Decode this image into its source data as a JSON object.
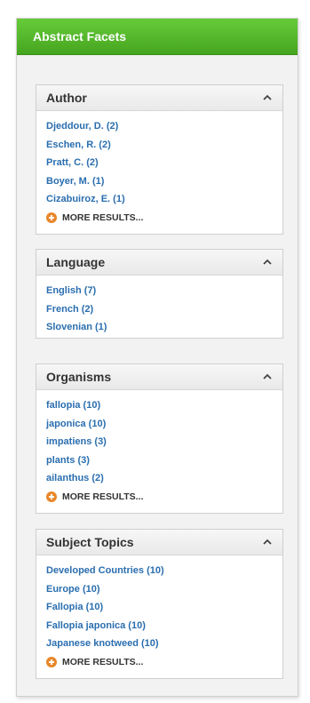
{
  "panel": {
    "title": "Abstract Facets"
  },
  "facets": [
    {
      "title": "Author",
      "items": [
        "Djeddour, D. (2)",
        "Eschen, R. (2)",
        "Pratt, C. (2)",
        "Boyer, M. (1)",
        "Cizabuiroz, E. (1)"
      ],
      "more": "MORE RESULTS..."
    },
    {
      "title": "Language",
      "items": [
        "English (7)",
        "French (2)",
        "Slovenian (1)"
      ]
    },
    {
      "title": "Organisms",
      "items": [
        "fallopia (10)",
        "japonica (10)",
        "impatiens (3)",
        "plants (3)",
        "ailanthus (2)"
      ],
      "more": "MORE RESULTS..."
    },
    {
      "title": "Subject Topics",
      "items": [
        "Developed Countries (10)",
        "Europe (10)",
        "Fallopia (10)",
        "Fallopia japonica (10)",
        "Japanese knotweed (10)"
      ],
      "more": "MORE RESULTS..."
    }
  ],
  "icons": {
    "collapse": "chevron-up-icon",
    "more": "plus-circle-icon"
  },
  "colors": {
    "header_green": "#4cae24",
    "link_blue": "#2a6eaf",
    "more_orange": "#e8872a"
  }
}
